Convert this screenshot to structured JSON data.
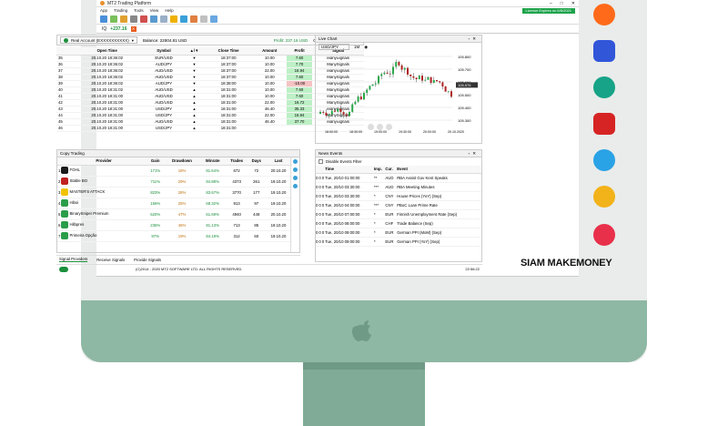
{
  "window": {
    "title": "MT2 Trading Platform",
    "license": "License Expires on 6/6/2021"
  },
  "menu": [
    "App",
    "Trading",
    "Tools",
    "View",
    "Help"
  ],
  "tab": {
    "label": "IQ",
    "value": "+237.16"
  },
  "account": {
    "name": "Real Account (EXXXXXXXXXX)",
    "balance": "Balance: 22804.81 USD",
    "profit": "Profit: 237.16 USD",
    "open_volume": "Open Volume: 20.00 USD"
  },
  "positions": {
    "headers": [
      "",
      "Open Time",
      "Symbol",
      "▲/▼",
      "Close Time",
      "Amount",
      "Profit",
      "Signal"
    ],
    "rows": [
      [
        "35",
        "20.10.20 18:36:02",
        "EUR/USD",
        "▼",
        "18:37:00",
        "10.00",
        "7.60",
        "ManySignals",
        "g"
      ],
      [
        "36",
        "20.10.20 18:36:02",
        "AUD/JPY",
        "▼",
        "18:37:00",
        "10.00",
        "7.70",
        "ManySignals",
        "g"
      ],
      [
        "37",
        "20.10.20 18:36:02",
        "AUD/USD",
        "▼",
        "18:37:00",
        "22.00",
        "16.94",
        "ManySignals",
        "g"
      ],
      [
        "38",
        "20.10.20 18:36:02",
        "AUD/USD",
        "▼",
        "18:37:00",
        "10.00",
        "7.60",
        "ManySignals",
        "g"
      ],
      [
        "39",
        "20.10.20 18:36:02",
        "AUD/JPY",
        "▼",
        "18:38:00",
        "10.00",
        "-10.00",
        "ManySignals",
        "r"
      ],
      [
        "40",
        "20.10.20 18:31:02",
        "AUD/USD",
        "▲",
        "18:31:00",
        "10.00",
        "7.60",
        "ManySignals",
        "g"
      ],
      [
        "41",
        "20.10.20 18:31:00",
        "AUD/USD",
        "▲",
        "18:31:00",
        "10.00",
        "7.60",
        "ManySignals",
        "g"
      ],
      [
        "42",
        "20.10.20 18:31:00",
        "AUD/USD",
        "▲",
        "18:31:00",
        "22.00",
        "16.72",
        "ManySignals",
        "g"
      ],
      [
        "43",
        "20.10.20 18:31:00",
        "USD/JPY",
        "▲",
        "18:31:00",
        "46.40",
        "35.33",
        "ManySignals",
        "g"
      ],
      [
        "44",
        "20.10.20 18:31:00",
        "USD/JPY",
        "▲",
        "18:31:00",
        "22.00",
        "16.94",
        "ManySignals",
        "g"
      ],
      [
        "45",
        "20.10.20 18:31:00",
        "AUD/USD",
        "▲",
        "18:31:00",
        "46.40",
        "37.70",
        "ManySignals",
        "g"
      ],
      [
        "46",
        "20.10.20 18:31:00",
        "USD/JPY",
        "▲",
        "18:31:00",
        "",
        "",
        "",
        ""
      ]
    ]
  },
  "chart": {
    "title": "Live Chart",
    "symbol": "USD/JPY",
    "timeframe": "1M",
    "prices": [
      "105.800",
      "105.700",
      "105.600",
      "105.500",
      "105.400",
      "105.300"
    ],
    "current": "105.576",
    "times": [
      "18:00:00",
      "18:30:00",
      "19:00:00",
      "19:30:00",
      "20:00:00",
      "20.10.2020"
    ]
  },
  "copy": {
    "title": "Copy Trading",
    "headers": [
      "",
      "Provider",
      "",
      "Gain",
      "Drawdown",
      "Winrate",
      "Trades",
      "Days",
      "Last"
    ],
    "rows": [
      [
        "1",
        "FOHL",
        "",
        "171%",
        "18%",
        "81.64%",
        "672",
        "72",
        "20.10.20",
        "#1a1a1a"
      ],
      [
        "2",
        "Stable BO",
        "",
        "711%",
        "29%",
        "84.88%",
        "4373",
        "261",
        "19.10.20",
        "#c02020"
      ],
      [
        "3",
        "MASTER'S ATTACK",
        "",
        "823%",
        "28%",
        "83.67%",
        "3770",
        "177",
        "19.10.20",
        "#f2c200"
      ],
      [
        "4",
        "Hiboi",
        "",
        "156%",
        "25%",
        "68.32%",
        "913",
        "97",
        "19.10.20",
        "#2a9d4a"
      ],
      [
        "5",
        "BinarySniper Premium",
        "",
        "520%",
        "47%",
        "61.69%",
        "4940",
        "448",
        "20.10.20",
        "#2a9d4a"
      ],
      [
        "6",
        "Hilbpres",
        "",
        "235%",
        "46%",
        "81.13%",
        "713",
        "85",
        "19.10.20",
        "#2a9d4a"
      ],
      [
        "7",
        "Primeira Opção",
        "",
        "97%",
        "19%",
        "84.18%",
        "312",
        "60",
        "19.10.20",
        "#2a9d4a"
      ]
    ]
  },
  "bottom_tabs": [
    "Signal Providers",
    "Receive Signals",
    "Provide Signals"
  ],
  "status": {
    "copyright": "(C)2014 - 2020 MT2 SOFTWARE LTD. ALL RIGHTS RESERVED.",
    "clock": "22:56:22"
  },
  "news": {
    "title": "News Events",
    "filter": "Disable Events Filter",
    "headers": [
      "",
      "",
      "",
      "Time",
      "Imp.",
      "Cur.",
      "Event"
    ],
    "rows": [
      [
        "0",
        "0",
        "0",
        "Tue, 20/10 01:00:00",
        "**",
        "AUD",
        "RBA Assist Gov Kent Speaks"
      ],
      [
        "0",
        "0",
        "0",
        "Tue, 20/10 03:30:00",
        "***",
        "AUD",
        "RBA Meeting Minutes"
      ],
      [
        "0",
        "0",
        "0",
        "Tue, 20/10 03:30:00",
        "*",
        "CNY",
        "House Prices (YoY) (Sep)"
      ],
      [
        "0",
        "0",
        "0",
        "Tue, 20/10 04:00:00",
        "***",
        "CNY",
        "PBoC Loan Prime Rate"
      ],
      [
        "0",
        "0",
        "0",
        "Tue, 20/10 07:00:00",
        "*",
        "EUR",
        "Finnish Unemployment Rate (Sep)"
      ],
      [
        "0",
        "0",
        "0",
        "Tue, 20/10 08:00:00",
        "*",
        "CHF",
        "Trade Balance (Sep)"
      ],
      [
        "0",
        "0",
        "0",
        "Tue, 20/10 09:00:00",
        "*",
        "EUR",
        "German PPI (MoM) (Sep)"
      ],
      [
        "0",
        "0",
        "0",
        "Tue, 20/10 09:00:00",
        "*",
        "EUR",
        "German PPI (YoY) (Sep)"
      ]
    ]
  },
  "brand": "SIAM MAKEMONEY",
  "colors": {
    "monitor": "#8eb8a4",
    "profit_green": "#bdf0c6",
    "loss_red": "#f5c2c2",
    "accent": "#1a8f3c"
  }
}
